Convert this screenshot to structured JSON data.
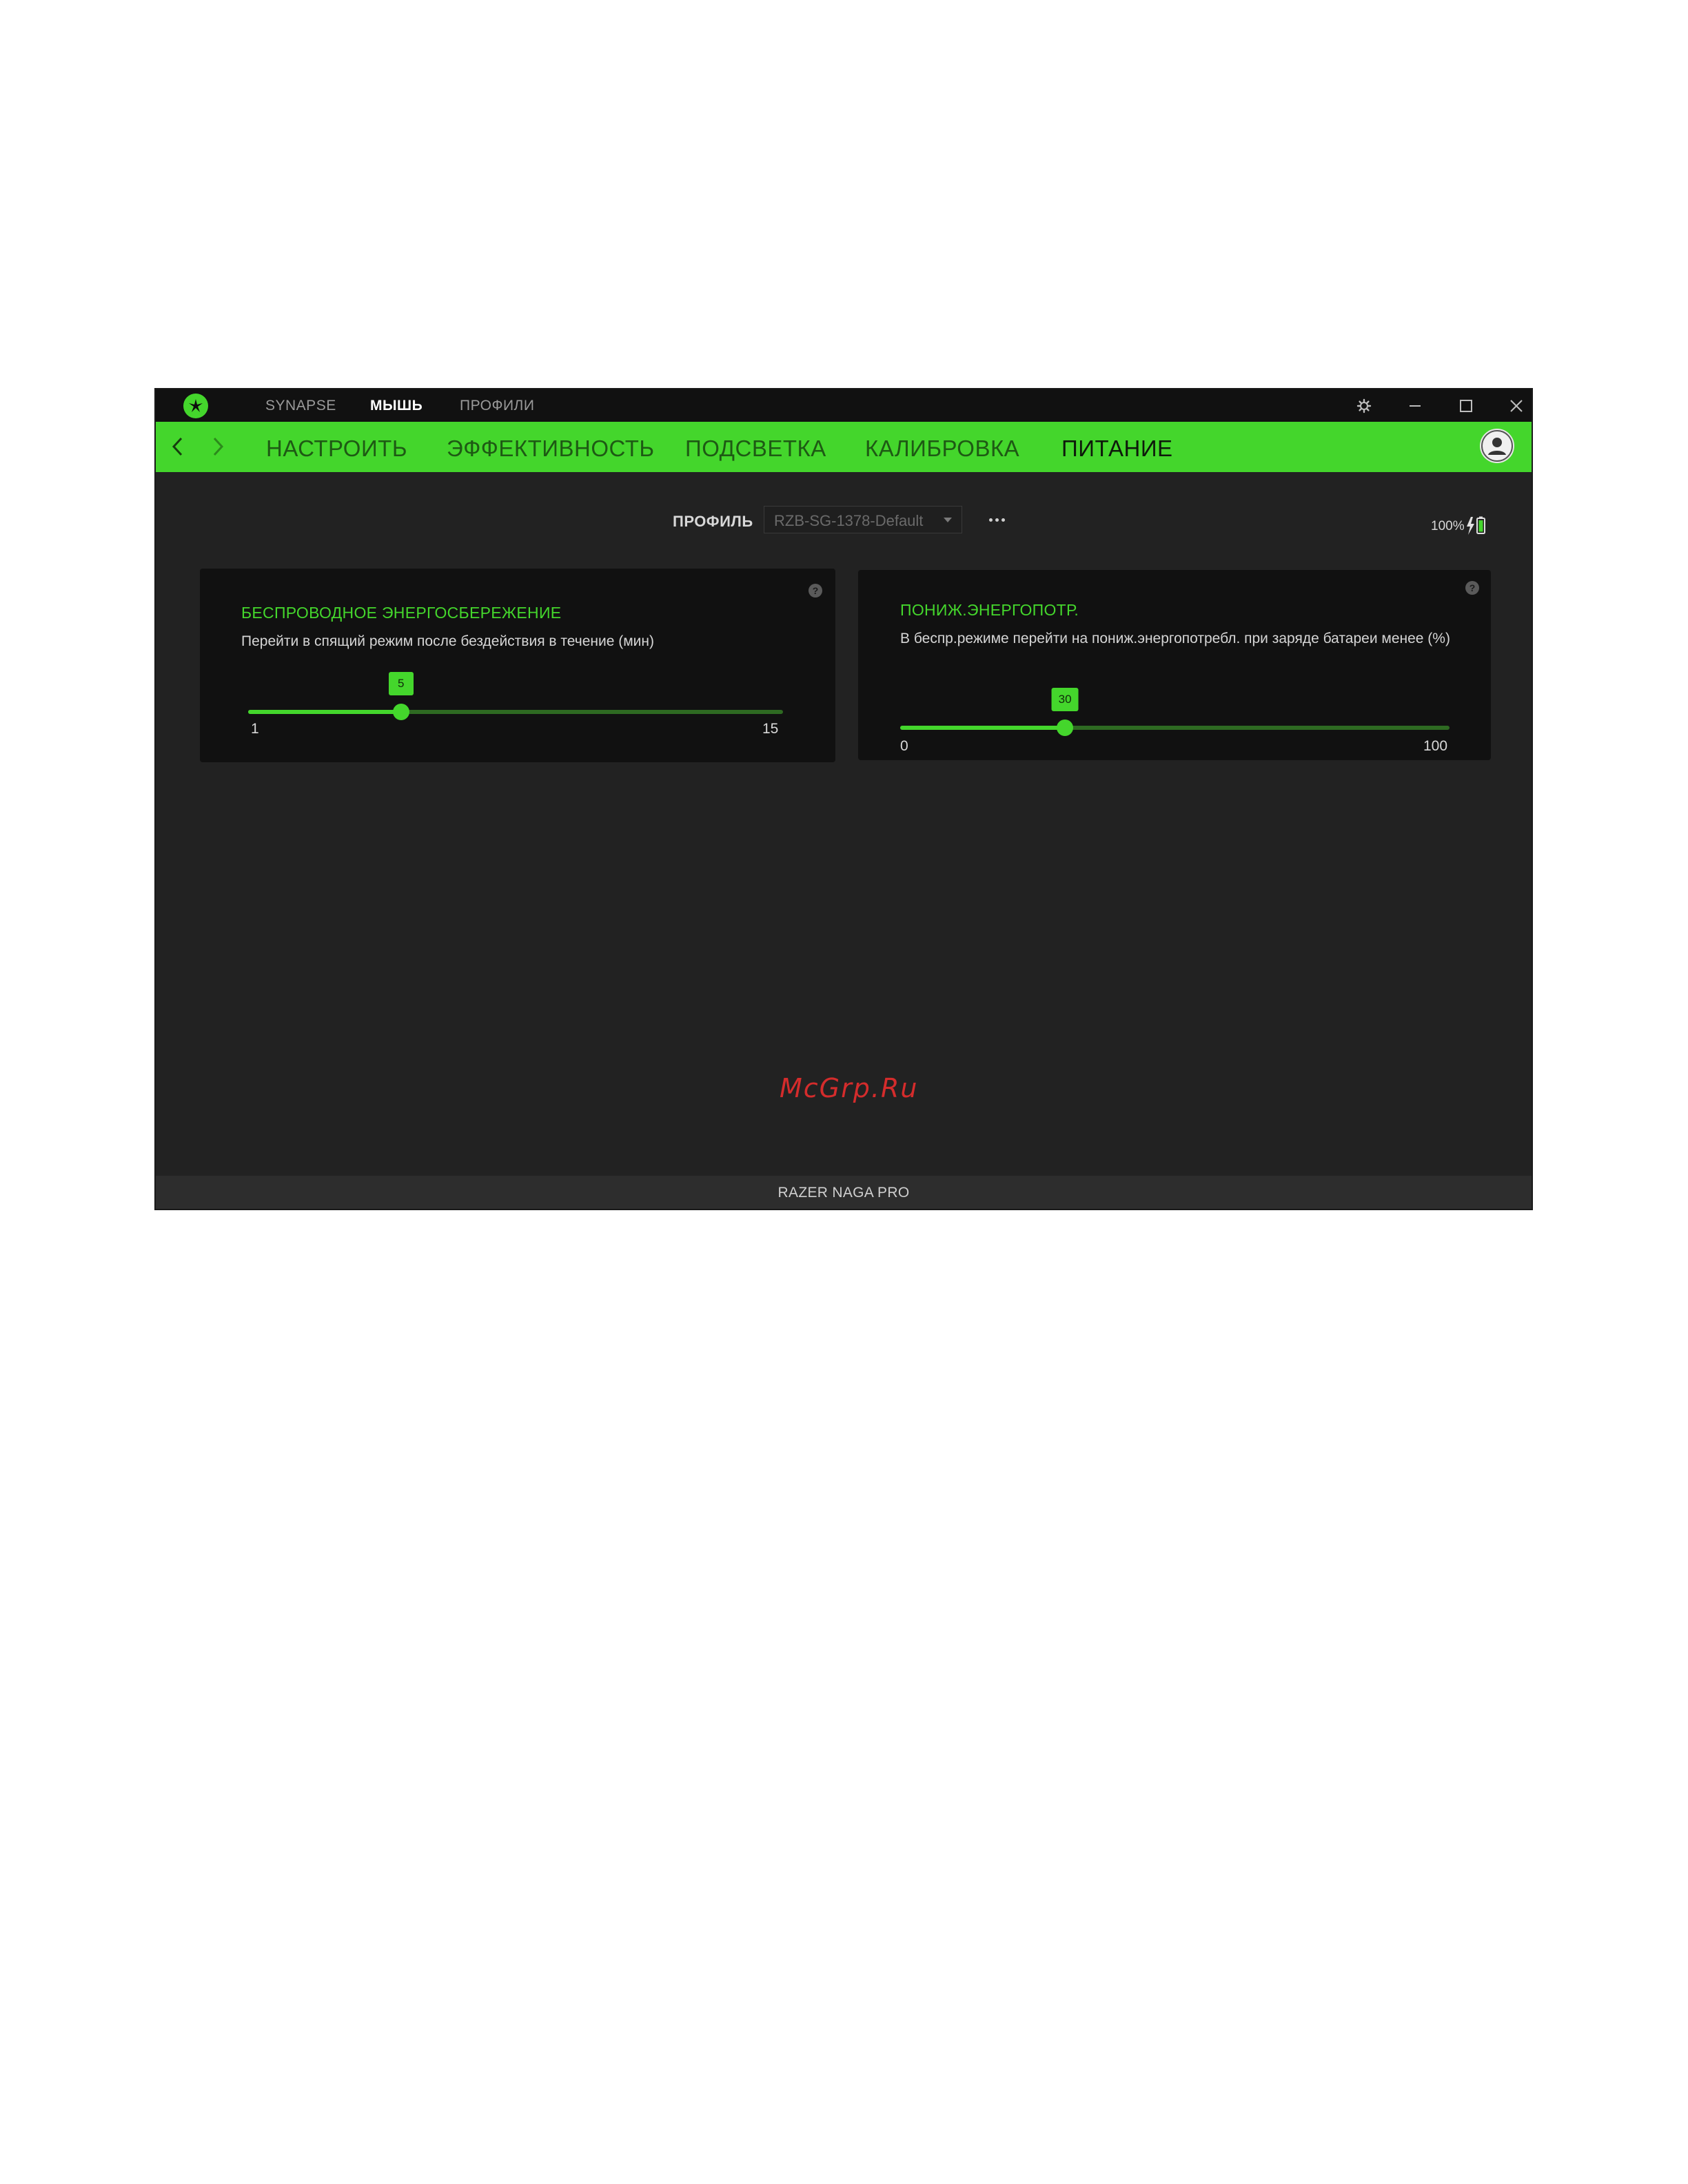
{
  "titlebar": {
    "tabs": [
      {
        "label": "SYNAPSE",
        "active": false
      },
      {
        "label": "МЫШЬ",
        "active": true
      },
      {
        "label": "ПРОФИЛИ",
        "active": false
      }
    ]
  },
  "nav": {
    "tabs": [
      {
        "label": "НАСТРОИТЬ",
        "active": false
      },
      {
        "label": "ЭФФЕКТИВНОСТЬ",
        "active": false
      },
      {
        "label": "ПОДСВЕТКА",
        "active": false
      },
      {
        "label": "КАЛИБРОВКА",
        "active": false
      },
      {
        "label": "ПИТАНИЕ",
        "active": true
      }
    ]
  },
  "profile": {
    "label": "ПРОФИЛЬ",
    "selected": "RZB-SG-1378-Default"
  },
  "battery": {
    "level_text": "100%",
    "charging": true
  },
  "panels": [
    {
      "title": "БЕСПРОВОДНОЕ ЭНЕРГОСБЕРЕЖЕНИЕ",
      "description": "Перейти в спящий режим после бездействия в течение (мин)",
      "help": "?",
      "slider": {
        "min": 1,
        "max": 15,
        "value": 5,
        "min_label": "1",
        "max_label": "15",
        "value_label": "5"
      }
    },
    {
      "title": "ПОНИЖ.ЭНЕРГОПОТР.",
      "description": "В беспр.режиме перейти на пониж.энергопотребл. при заряде батареи менее (%)",
      "help": "?",
      "slider": {
        "min": 0,
        "max": 100,
        "value": 30,
        "min_label": "0",
        "max_label": "100",
        "value_label": "30"
      }
    }
  ],
  "watermark": "McGrp.Ru",
  "status": {
    "device_name": "RAZER NAGA PRO"
  },
  "colors": {
    "accent": "#44d62c",
    "window_bg": "#222222",
    "panel_bg": "#111111"
  },
  "icons": {
    "logo": "razer-logo-icon",
    "settings": "gear-icon",
    "minimize": "minimize-icon",
    "maximize": "maximize-icon",
    "close": "close-icon",
    "back": "chevron-left-icon",
    "forward": "chevron-right-icon",
    "more": "more-horizontal-icon",
    "battery": "battery-charging-icon",
    "avatar": "user-avatar-icon"
  }
}
